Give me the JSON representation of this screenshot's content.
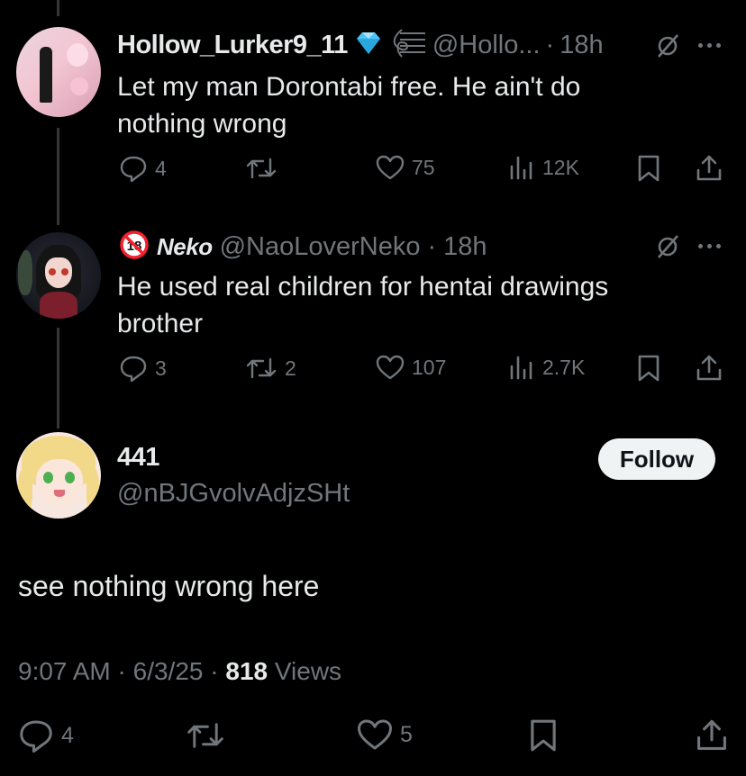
{
  "tweets": [
    {
      "name": "Hollow_Lurker9_11",
      "handle": "@Hollo...",
      "dot": "·",
      "time": "18h",
      "text": "Let my man Dorontabi free. He ain't do nothing wrong",
      "replies": "4",
      "retweets": "",
      "likes": "75",
      "views": "12K"
    },
    {
      "name": "Neko",
      "handle": "@NaoLoverNeko",
      "dot": "·",
      "time": "18h",
      "text": "He used real children for hentai drawings brother",
      "replies": "3",
      "retweets": "2",
      "likes": "107",
      "views": "2.7K"
    }
  ],
  "main": {
    "name": "441",
    "handle": "@nBJGvolvAdjzSHt",
    "follow_label": "Follow",
    "text": "see nothing wrong here",
    "time": "9:07 AM",
    "date": "6/3/25",
    "views_count": "818",
    "views_label": "Views",
    "replies": "4",
    "likes": "5"
  },
  "colors": {
    "background": "#000000",
    "text": "#e7e9ea",
    "muted": "#71767b",
    "verified": "#4fc3f7",
    "nsfw": "#f4212e"
  },
  "icons": [
    "reply-icon",
    "retweet-icon",
    "like-icon",
    "views-icon",
    "bookmark-icon",
    "share-icon",
    "grok-icon",
    "more-icon",
    "diamond-icon",
    "music-icon",
    "no-18-icon"
  ]
}
